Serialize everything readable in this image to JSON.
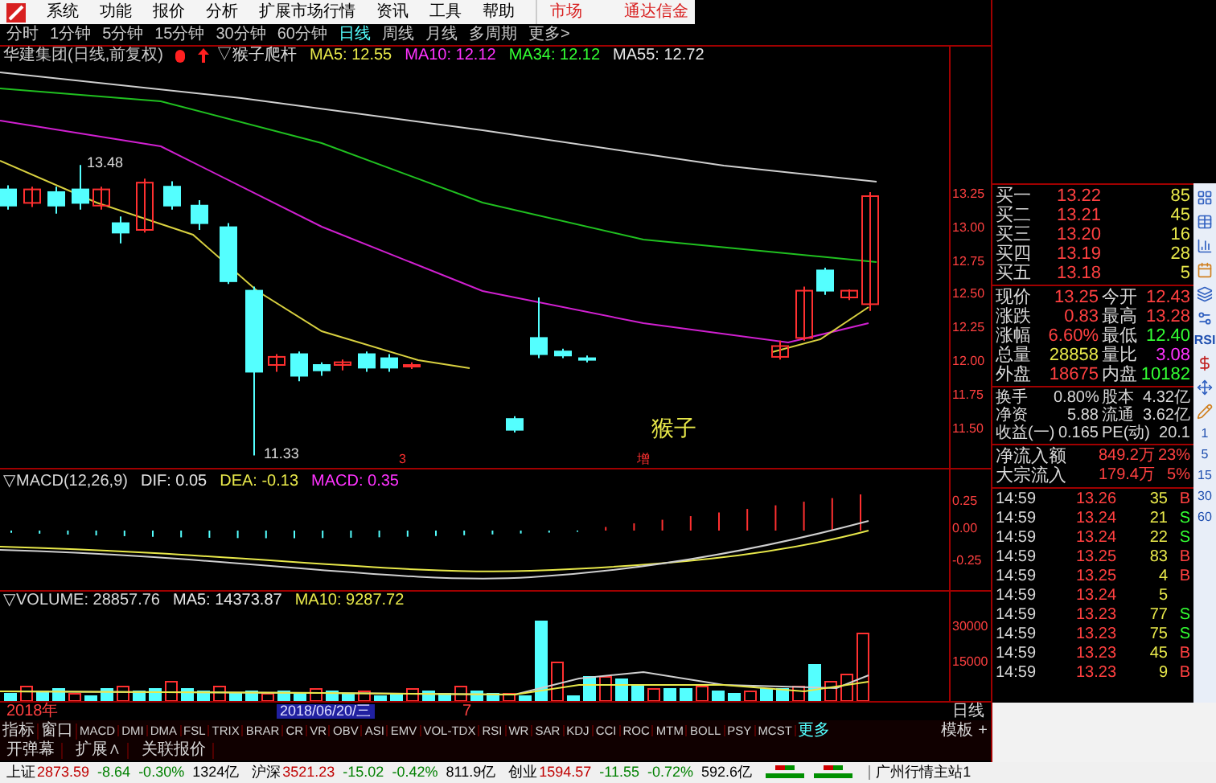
{
  "menu": {
    "items": [
      "系统",
      "功能",
      "报价",
      "分析",
      "扩展市场行情",
      "资讯",
      "工具",
      "帮助"
    ],
    "market_tab": "市场",
    "brand": "通达信金"
  },
  "periods": [
    {
      "label": "分时",
      "selected": false
    },
    {
      "label": "1分钟",
      "selected": false
    },
    {
      "label": "5分钟",
      "selected": false
    },
    {
      "label": "15分钟",
      "selected": false
    },
    {
      "label": "30分钟",
      "selected": false
    },
    {
      "label": "60分钟",
      "selected": false
    },
    {
      "label": "日线",
      "selected": true
    },
    {
      "label": "周线",
      "selected": false
    },
    {
      "label": "月线",
      "selected": false
    },
    {
      "label": "多周期",
      "selected": false
    },
    {
      "label": "更多>",
      "selected": false
    }
  ],
  "main_chart": {
    "title": "华建集团(日线,前复权)",
    "formula": "▽猴子爬杆",
    "indicators": [
      {
        "label": "MA5: 12.55",
        "color": "#e8e84a"
      },
      {
        "label": "MA10: 12.12",
        "color": "#ff33ff"
      },
      {
        "label": "MA34: 12.12",
        "color": "#33ff33"
      },
      {
        "label": "MA55: 12.72",
        "color": "#e6e6e6"
      }
    ],
    "high_label": "13.48",
    "low_label": "11.33",
    "pattern_label": "猴子",
    "markers": [
      "3",
      "增"
    ],
    "yticks": [
      "13.25",
      "13.00",
      "12.75",
      "12.50",
      "12.25",
      "12.00",
      "11.75",
      "11.50"
    ]
  },
  "macd": {
    "title": "▽MACD(12,26,9)",
    "values": [
      {
        "label": "DIF: 0.05",
        "color": "#e6e6e6"
      },
      {
        "label": "DEA: -0.13",
        "color": "#e8e84a"
      },
      {
        "label": "MACD: 0.35",
        "color": "#ff33ff"
      }
    ],
    "yticks": [
      "0.25",
      "0.00",
      "-0.25"
    ]
  },
  "volume": {
    "title": "▽VOLUME: 28857.76",
    "values": [
      {
        "label": "MA5: 14373.87",
        "color": "#e6e6e6"
      },
      {
        "label": "MA10: 9287.72",
        "color": "#e8e84a"
      }
    ],
    "yticks": [
      "30000",
      "15000"
    ]
  },
  "date_axis": {
    "year": "2018年",
    "cursor_date": "2018/06/20/三",
    "tick": "7",
    "period": "日线"
  },
  "indicator_tabs": {
    "items": [
      "指标",
      "窗口",
      "MACD",
      "DMI",
      "DMA",
      "FSL",
      "TRIX",
      "BRAR",
      "CR",
      "VR",
      "OBV",
      "ASI",
      "EMV",
      "VOL-TDX",
      "RSI",
      "WR",
      "SAR",
      "KDJ",
      "CCI",
      "ROC",
      "MTM",
      "BOLL",
      "PSY",
      "MCST"
    ],
    "more": "更多",
    "template": "模板",
    "add": "+"
  },
  "bottom_links": [
    "开弹幕",
    "扩展∧",
    "关联报价"
  ],
  "bids": [
    {
      "label": "买一",
      "price": "13.22",
      "volume": "85"
    },
    {
      "label": "买二",
      "price": "13.21",
      "volume": "45"
    },
    {
      "label": "买三",
      "price": "13.20",
      "volume": "16"
    },
    {
      "label": "买四",
      "price": "13.19",
      "volume": "28"
    },
    {
      "label": "买五",
      "price": "13.18",
      "volume": "5"
    }
  ],
  "quote": [
    {
      "left": {
        "label": "现价",
        "value": "13.25",
        "color": "#ff4040"
      },
      "right": {
        "label": "今开",
        "value": "12.43",
        "color": "#ff4040"
      }
    },
    {
      "left": {
        "label": "涨跌",
        "value": "0.83",
        "color": "#ff4040"
      },
      "right": {
        "label": "最高",
        "value": "13.28",
        "color": "#ff4040"
      }
    },
    {
      "left": {
        "label": "涨幅",
        "value": "6.60%",
        "color": "#ff4040"
      },
      "right": {
        "label": "最低",
        "value": "12.40",
        "color": "#33ff33"
      }
    },
    {
      "left": {
        "label": "总量",
        "value": "28858",
        "color": "#e8e84a"
      },
      "right": {
        "label": "量比",
        "value": "3.08",
        "color": "#ff33ff"
      }
    },
    {
      "left": {
        "label": "外盘",
        "value": "18675",
        "color": "#ff4040"
      },
      "right": {
        "label": "内盘",
        "value": "10182",
        "color": "#33ff33"
      }
    }
  ],
  "stats": [
    {
      "label": "换手",
      "value": "0.80%",
      "label2": "股本",
      "value2": "4.32亿"
    },
    {
      "label": "净资",
      "value": "5.88",
      "label2": "流通",
      "value2": "3.62亿"
    },
    {
      "label": "收益(一)",
      "value": "0.165",
      "label2": "PE(动)",
      "value2": "20.1"
    }
  ],
  "flows": [
    {
      "label": "净流入额",
      "amount": "849.2万",
      "pct": "23%"
    },
    {
      "label": "大宗流入",
      "amount": "179.4万",
      "pct": "5%"
    }
  ],
  "ticks": [
    {
      "time": "14:59",
      "price": "13.26",
      "volume": "35",
      "side": "B",
      "kind": "buy"
    },
    {
      "time": "14:59",
      "price": "13.24",
      "volume": "21",
      "side": "S",
      "kind": "sell"
    },
    {
      "time": "14:59",
      "price": "13.24",
      "volume": "22",
      "side": "S",
      "kind": "sell"
    },
    {
      "time": "14:59",
      "price": "13.25",
      "volume": "83",
      "side": "B",
      "kind": "buy"
    },
    {
      "time": "14:59",
      "price": "13.25",
      "volume": "4",
      "side": "B",
      "kind": "buy"
    },
    {
      "time": "14:59",
      "price": "13.24",
      "volume": "5",
      "kind": "none"
    },
    {
      "time": "14:59",
      "price": "13.23",
      "volume": "77",
      "side": "S",
      "kind": "sell"
    },
    {
      "time": "14:59",
      "price": "13.23",
      "volume": "75",
      "side": "S",
      "kind": "sell"
    },
    {
      "time": "14:59",
      "price": "13.23",
      "volume": "45",
      "side": "B",
      "kind": "buy"
    },
    {
      "time": "14:59",
      "price": "13.23",
      "volume": "9",
      "side": "B",
      "kind": "buy"
    }
  ],
  "right_toolbar": {
    "rsi": "RSI",
    "periods": [
      "1",
      "5",
      "15",
      "30",
      "60"
    ]
  },
  "status_bar": {
    "indexes": [
      {
        "name": "上证",
        "value": "2873.59",
        "change": "-8.64",
        "pct": "-0.30%",
        "amount": "1324亿"
      },
      {
        "name": "沪深",
        "value": "3521.23",
        "change": "-15.02",
        "pct": "-0.42%",
        "amount": "811.9亿"
      },
      {
        "name": "创业",
        "value": "1594.57",
        "change": "-11.55",
        "pct": "-0.72%",
        "amount": "592.6亿"
      }
    ],
    "server": "广州行情主站1"
  }
}
